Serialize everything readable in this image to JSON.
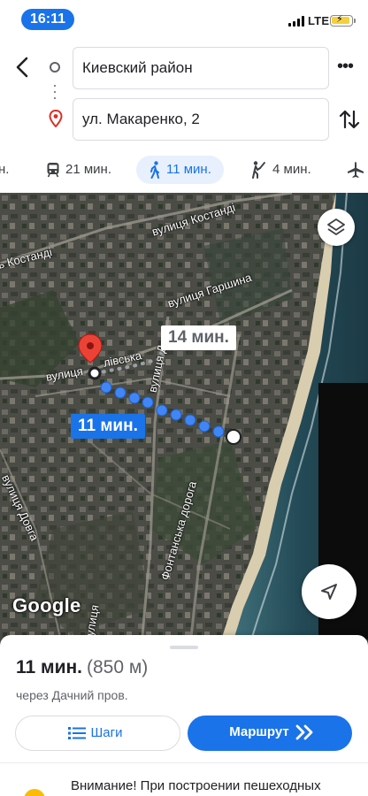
{
  "status_bar": {
    "time": "16:11",
    "network": "LTE"
  },
  "route": {
    "origin": "Киевский район",
    "destination": "ул. Макаренко, 2"
  },
  "modes": [
    {
      "label": "н.",
      "icon": "car-icon"
    },
    {
      "label": "21 мин.",
      "icon": "train-icon"
    },
    {
      "label": "11 мин.",
      "icon": "walk-icon",
      "active": true
    },
    {
      "label": "4 мин.",
      "icon": "ride-share-icon"
    },
    {
      "label": "",
      "icon": "airplane-icon"
    }
  ],
  "map": {
    "streets": {
      "kostandi_top": "вулиця Костанді",
      "kostandi_left": "ь Костанді",
      "garshina": "вулиця Гаршина",
      "street_left": "вулиця",
      "street_left_end": "лівська",
      "vertical_street": "вулиця Д",
      "dovga": "вулиця Довга",
      "fontanska": "Фонтанська дорога",
      "bottom_cut": "вулиця"
    },
    "route_time_alt": "14 мин.",
    "route_time_main": "11 мин.",
    "logo": "Google",
    "colors": {
      "route": "#4285f4",
      "pin": "#ea4335",
      "accent": "#1a73e8"
    }
  },
  "summary": {
    "time": "11 мин.",
    "distance": "(850 м)",
    "via": "через Дачний пров.",
    "steps_label": "Шаги",
    "route_label": "Маршрут",
    "notice": "Внимание! При построении пешеходных"
  }
}
